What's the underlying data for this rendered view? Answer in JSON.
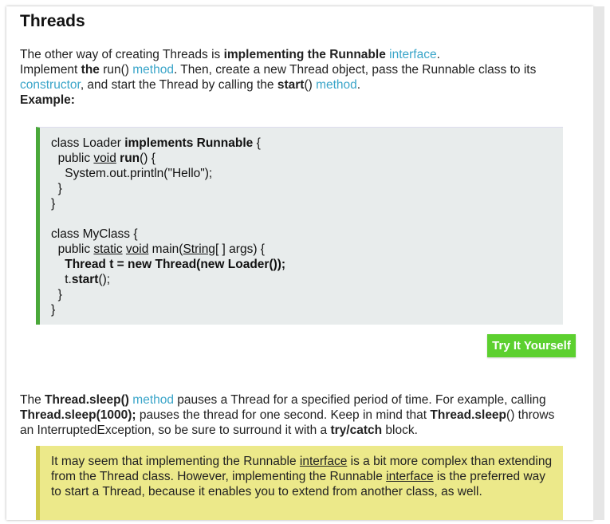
{
  "section": {
    "title": "Threads"
  },
  "intro": {
    "l1_a": "The other way of creating Threads is ",
    "l1_b": "implementing the Runnable",
    "l1_link": "interface",
    "l1_c": ".",
    "l2_a": "Implement ",
    "l2_b": "the",
    "l2_c": " run() ",
    "l2_link": "method",
    "l2_d": ". Then, create a new Thread object, pass the Runnable class to its",
    "l3_link": "constructor",
    "l3_a": ", and start the Thread by calling the ",
    "l3_b": "start",
    "l3_c": "() ",
    "l3_link2": "method",
    "l3_d": ".",
    "example_label": "Example:"
  },
  "code": {
    "l1_a": "class Loader ",
    "l1_b": "implements Runnable",
    "l1_c": " {",
    "l2_a": "  public ",
    "l2_b": "void",
    "l2_c": " ",
    "l2_d": "run",
    "l2_e": "() {",
    "l3": "    System.out.println(\"Hello\");",
    "l4": "  }",
    "l5": "}",
    "l6": "",
    "l7": "class MyClass {",
    "l8_a": "  public ",
    "l8_b": "static",
    "l8_c": " ",
    "l8_d": "void",
    "l8_e": " main(",
    "l8_f": "String",
    "l8_g": "[ ] args) {",
    "l9": "    Thread t = new Thread(new Loader());",
    "l10_a": "    t.",
    "l10_b": "start",
    "l10_c": "();",
    "l11": "  }",
    "l12": "}"
  },
  "try_button": {
    "label": "Try It Yourself"
  },
  "sleep_para": {
    "a": "The ",
    "b": "Thread.sleep()",
    "link": "method",
    "c": " pauses a Thread for a specified period of time. For example, calling",
    "d": "Thread.sleep(1000);",
    "e": " pauses the thread for one second. Keep in mind that ",
    "f": "Thread.sleep",
    "g": "() throws",
    "h": "an InterruptedException, so be sure to surround it with a ",
    "i": "try/catch",
    "j": " block."
  },
  "note": {
    "a": "It may seem that implementing the Runnable ",
    "u1": "interface",
    "b": " is a bit more complex than extending from the Thread class. However, implementing the Runnable ",
    "u2": "interface",
    "c": " is the preferred way to start a Thread, because it enables you to extend from another class, as well."
  },
  "colors": {
    "link": "#3aa5c9",
    "code_border": "#4aa83a",
    "code_bg": "#e8ecec",
    "button_bg": "#5cd02f",
    "note_bg": "#ece98a",
    "note_border": "#cfc94a"
  }
}
